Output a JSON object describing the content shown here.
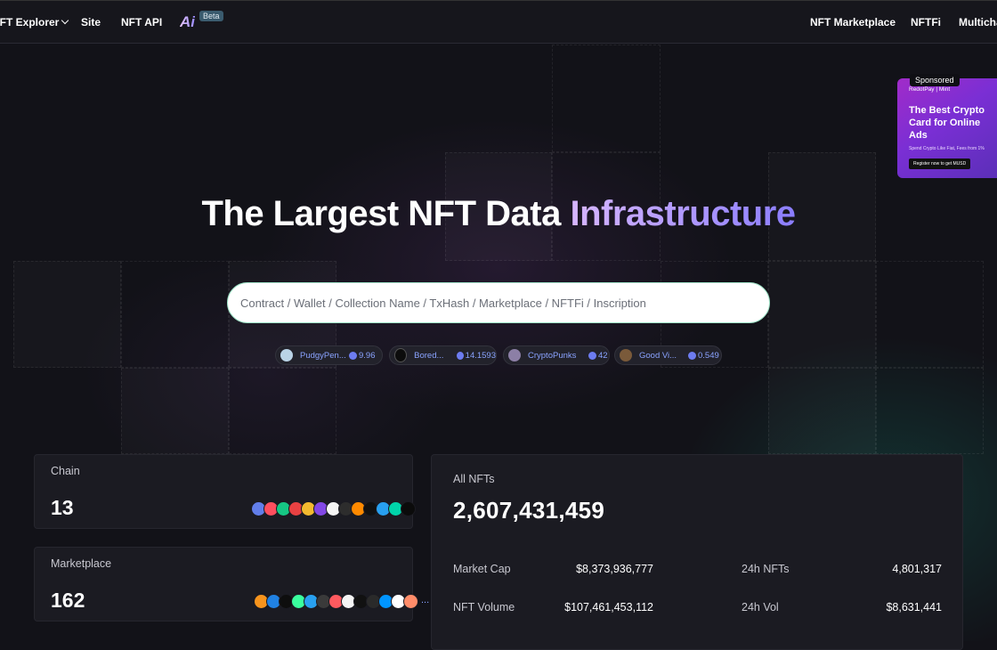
{
  "nav": {
    "left": [
      {
        "label": "NFT Explorer",
        "dropdown": true
      },
      {
        "label": "Site"
      },
      {
        "label": "NFT API"
      }
    ],
    "ai_logo": "Ai",
    "ai_badge": "Beta",
    "right": [
      {
        "label": "NFT Marketplace"
      },
      {
        "label": "NFTFi"
      },
      {
        "label": "Multichain"
      }
    ]
  },
  "ad": {
    "sponsored": "Sponsored",
    "brand": "RedotPay | Mint",
    "title": "The Best Crypto Card for Online Ads",
    "subtitle": "Spend Crypto Like Fiat, Fees from 1%",
    "button": "Register now to get MUSD"
  },
  "hero": {
    "title_plain": "The Largest NFT Data ",
    "title_highlight": "Infrastructure"
  },
  "search": {
    "placeholder": "Contract / Wallet / Collection Name / TxHash / Marketplace / NFTFi / Inscription"
  },
  "trending": [
    {
      "name": "PudgyPen...",
      "price": "9.96",
      "color": "#b9d3e6"
    },
    {
      "name": "Bored...",
      "price": "14.1593",
      "color": "#0c0c0c"
    },
    {
      "name": "CryptoPunks",
      "price": "42",
      "color": "#8c7fa6"
    },
    {
      "name": "Good Vi...",
      "price": "0.549",
      "color": "#7a5a3a"
    }
  ],
  "stats": {
    "chain": {
      "label": "Chain",
      "value": "13"
    },
    "marketplace": {
      "label": "Marketplace",
      "value": "162",
      "more": "..."
    },
    "all_nfts": {
      "label": "All NFTs",
      "value": "2,607,431,459"
    },
    "market_cap": {
      "label": "Market Cap",
      "value": "$8,373,936,777"
    },
    "nfts_24h": {
      "label": "24h NFTs",
      "value": "4,801,317"
    },
    "nft_volume": {
      "label": "NFT Volume",
      "value": "$107,461,453,112"
    },
    "vol_24h": {
      "label": "24h Vol",
      "value": "$8,631,441"
    }
  },
  "chain_icons": [
    "#627eea",
    "#ff4f5e",
    "#16c784",
    "#e84142",
    "#f3ba2f",
    "#8247e5",
    "#f5f5f5",
    "#2d2d2d",
    "#ff8a00",
    "#111111",
    "#28a0f0",
    "#00d4aa",
    "#0b0b0b"
  ],
  "market_icons": [
    "#f7941d",
    "#2081e2",
    "#0e0e0e",
    "#3aff9e",
    "#28a0f0",
    "#3a3a3a",
    "#ff5a5f",
    "#f5f5f5",
    "#111111",
    "#2a2a2a",
    "#0095ff",
    "#ffffff",
    "#ff8c69"
  ]
}
